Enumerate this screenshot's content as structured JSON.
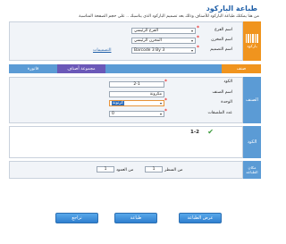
{
  "header": {
    "title": "طباعة الباركود",
    "subtitle": "من هنا يمكنك طباعة الباركود للأصناف وذلك بعد تصميم الباركود الذي يناسبك .. على حجم الصفحة المناسبة"
  },
  "settings": {
    "side_label": "باركود",
    "branch": {
      "label": "اسم الفرع",
      "value": "الفرع الرئيسي"
    },
    "warehouse": {
      "label": "اسم المخزن",
      "value": "المخزن الرئيسي"
    },
    "design": {
      "label": "اسم التصميم",
      "value": "Barcode 3 By 3"
    },
    "designs_link": "التصميمات"
  },
  "tabs": {
    "category": "صنف",
    "item_group": "مجموعة أصناف",
    "invoice": "فاتورة"
  },
  "item": {
    "side_label": "الصنف",
    "code": {
      "label": "الكود",
      "value": "2-1"
    },
    "item_name": {
      "label": "اسم الصنف",
      "value": "مكرونة"
    },
    "unit": {
      "label": "الوحدة",
      "value": "كرتونة"
    },
    "labels_count": {
      "label": "عدد الملصقات",
      "value": "0"
    }
  },
  "barcodes": {
    "side_label": "الكود",
    "entries": [
      "1-2"
    ]
  },
  "print_location": {
    "side_label": "مكان الطباعة",
    "row_label": "من السطر",
    "row_value": "1",
    "col_label": "من العمود",
    "col_value": "1"
  },
  "buttons": {
    "preview": "عرض الطباعة",
    "print": "طباعة",
    "close": "تراجع"
  },
  "colors": {
    "accent": "#2e8fd6",
    "orange": "#f0941e",
    "tab_blue": "#5b9bd5",
    "tab_purple": "#6a58b8"
  }
}
